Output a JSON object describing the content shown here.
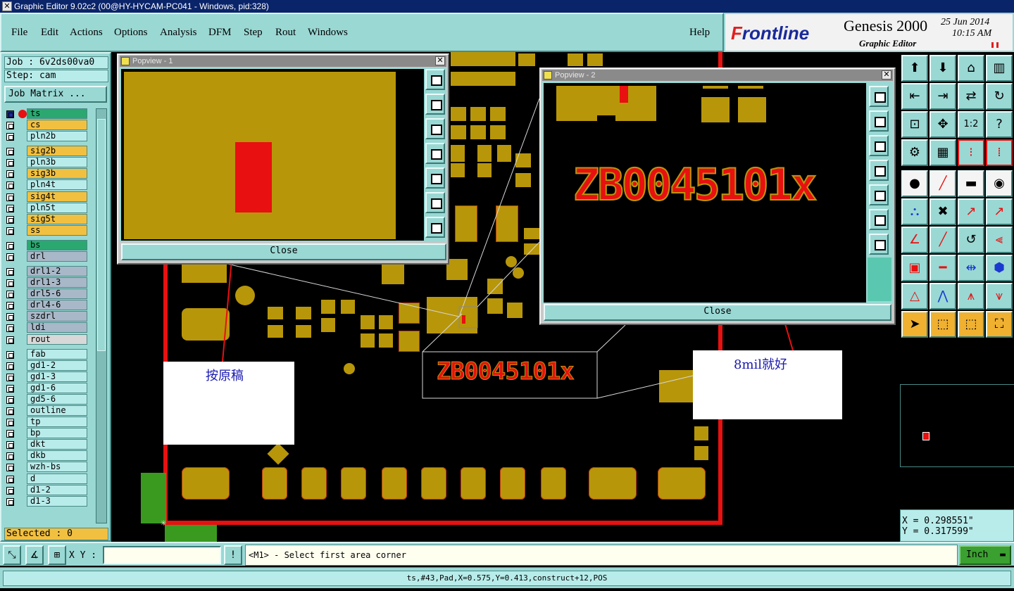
{
  "window": {
    "title": "Graphic Editor 9.02c2 (00@HY-HYCAM-PC041 - Windows, pid:328)"
  },
  "menu": {
    "items": [
      "File",
      "Edit",
      "Actions",
      "Options",
      "Analysis",
      "DFM",
      "Step",
      "Rout",
      "Windows"
    ],
    "help": "Help"
  },
  "brand": {
    "logo_prefix": "F",
    "logo_rest": "rontline",
    "product": "Genesis 2000",
    "subtitle": "Graphic Editor",
    "date": "25 Jun 2014",
    "time": "10:15 AM"
  },
  "job": {
    "job_label": "Job : 6v2ds00va0",
    "step_label": "Step: cam",
    "matrix_button": "Job Matrix ...",
    "selected": "Selected : 0"
  },
  "layers": [
    {
      "name": "ts",
      "color": "#2aa870"
    },
    {
      "name": "cs",
      "color": "#f2c040"
    },
    {
      "name": "pln2b",
      "color": "#b8ecea"
    },
    {
      "name": "sig2b",
      "color": "#f2c040"
    },
    {
      "name": "pln3b",
      "color": "#b8ecea"
    },
    {
      "name": "sig3b",
      "color": "#f2c040"
    },
    {
      "name": "pln4t",
      "color": "#b8ecea"
    },
    {
      "name": "sig4t",
      "color": "#f2c040"
    },
    {
      "name": "pln5t",
      "color": "#b8ecea"
    },
    {
      "name": "sig5t",
      "color": "#f2c040"
    },
    {
      "name": "ss",
      "color": "#f2c040"
    },
    {
      "name": "bs",
      "color": "#2aa870"
    },
    {
      "name": "drl",
      "color": "#a8b8c8"
    },
    {
      "name": "drl1-2",
      "color": "#a8b8c8"
    },
    {
      "name": "drl1-3",
      "color": "#a8b8c8"
    },
    {
      "name": "drl5-6",
      "color": "#a8b8c8"
    },
    {
      "name": "drl4-6",
      "color": "#a8b8c8"
    },
    {
      "name": "szdrl",
      "color": "#a8b8c8"
    },
    {
      "name": "ldi",
      "color": "#a8b8c8"
    },
    {
      "name": "rout",
      "color": "#d8d8d8"
    },
    {
      "name": "fab",
      "color": "#b8ecea"
    },
    {
      "name": "gd1-2",
      "color": "#b8ecea"
    },
    {
      "name": "gd1-3",
      "color": "#b8ecea"
    },
    {
      "name": "gd1-6",
      "color": "#b8ecea"
    },
    {
      "name": "gd5-6",
      "color": "#b8ecea"
    },
    {
      "name": "outline",
      "color": "#b8ecea"
    },
    {
      "name": "tp",
      "color": "#b8ecea"
    },
    {
      "name": "bp",
      "color": "#b8ecea"
    },
    {
      "name": "dkt",
      "color": "#b8ecea"
    },
    {
      "name": "dkb",
      "color": "#b8ecea"
    },
    {
      "name": "wzh-bs",
      "color": "#b8ecea"
    },
    {
      "name": "d",
      "color": "#b8ecea"
    },
    {
      "name": "d1-2",
      "color": "#b8ecea"
    },
    {
      "name": "d1-3",
      "color": "#b8ecea"
    }
  ],
  "popview1": {
    "title": "Popview - 1",
    "close": "Close"
  },
  "popview2": {
    "title": "Popview - 2",
    "close": "Close",
    "marking": "ZB0045101x"
  },
  "canvas": {
    "marking": "ZB0045101x"
  },
  "notes": {
    "left": "按原稿",
    "right": "8mil就好"
  },
  "tools": {
    "one_to_two": "1:2",
    "help_q": "?"
  },
  "coords": {
    "x": "X = 0.298551\"",
    "y": "Y = 0.317599\""
  },
  "command": {
    "xy_label": "X Y :",
    "prompt": "<M1> - Select first area corner",
    "unit": "Inch"
  },
  "status": {
    "text": "ts,#43,Pad,X=0.575,Y=0.413,construct+12,POS"
  },
  "colors": {
    "panel": "#9ad8d4",
    "copper": "#b8960a",
    "highlight": "#e81010",
    "board_edge": "#e81010"
  }
}
